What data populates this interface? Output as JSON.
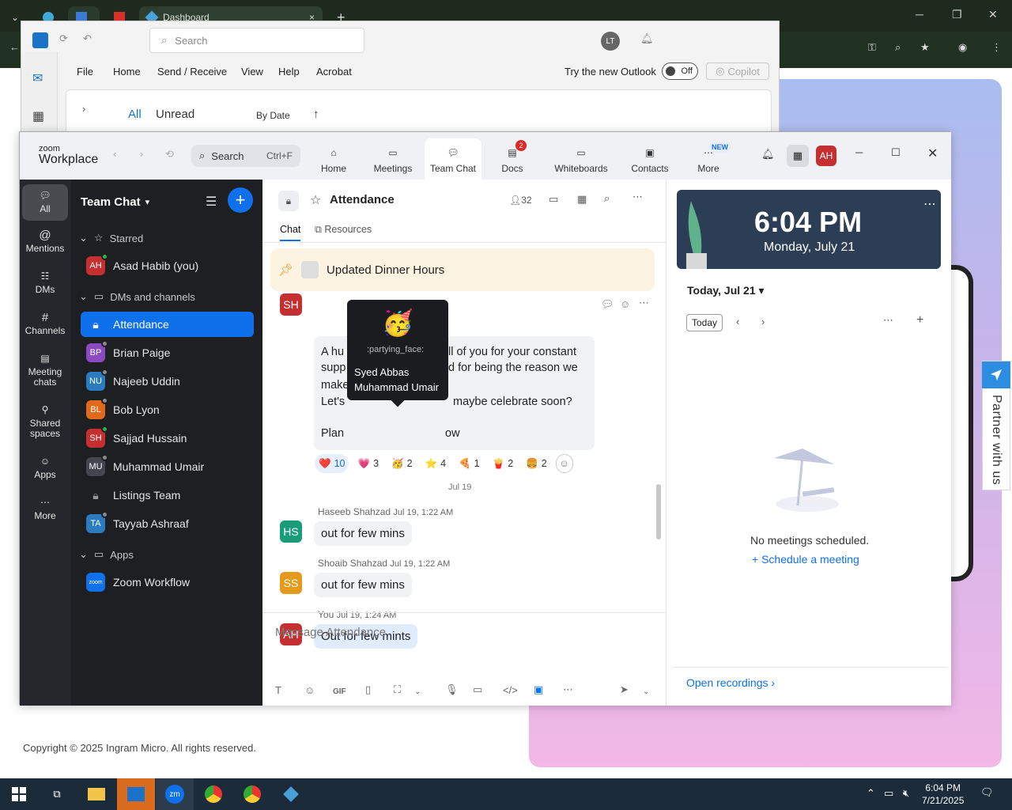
{
  "browser": {
    "tab_title": "Dashboard",
    "tab_close": "×",
    "new_tab": "+"
  },
  "outlook": {
    "search_placeholder": "Search",
    "user_initials": "LT",
    "menu": [
      "File",
      "Home",
      "Send / Receive",
      "View",
      "Help",
      "Acrobat"
    ],
    "try_new": "Try the new Outlook",
    "toggle": "Off",
    "copilot": "Copilot",
    "filters": {
      "all": "All",
      "unread": "Unread",
      "sort": "By Date",
      "sort_dir": "↑"
    }
  },
  "zoom": {
    "brand_top": "zoom",
    "brand": "Workplace",
    "search": "Search",
    "search_shortcut": "Ctrl+F",
    "tabs": [
      {
        "label": "Home"
      },
      {
        "label": "Meetings"
      },
      {
        "label": "Team Chat"
      },
      {
        "label": "Docs",
        "badge": "2"
      },
      {
        "label": "Whiteboards"
      },
      {
        "label": "Contacts"
      },
      {
        "label": "More",
        "badge": "NEW"
      }
    ],
    "user_initials": "AH",
    "rail": [
      "All",
      "Mentions",
      "DMs",
      "Channels",
      "Meeting chats",
      "Shared spaces",
      "Apps",
      "More"
    ],
    "sidebar": {
      "title": "Team Chat",
      "sections": {
        "starred": "Starred",
        "dms": "DMs and channels",
        "apps": "Apps"
      },
      "starred": [
        {
          "initials": "AH",
          "name": "Asad Habib (you)",
          "color": "#c62f2f",
          "status": "#2cb43f"
        }
      ],
      "items": [
        {
          "name": "Attendance",
          "type": "channel"
        },
        {
          "initials": "BP",
          "name": "Brian Paige",
          "color": "#8c4ac2",
          "status": "#8a8a8a"
        },
        {
          "initials": "NU",
          "name": "Najeeb Uddin",
          "color": "#2a7bc0",
          "status": "#8a8a8a"
        },
        {
          "initials": "BL",
          "name": "Bob Lyon",
          "color": "#e06a1a",
          "status": "#8a8a8a"
        },
        {
          "initials": "SH",
          "name": "Sajjad Hussain",
          "color": "#c62f2f",
          "status": "#2cb43f"
        },
        {
          "initials": "MU",
          "name": "Muhammad Umair",
          "color": "#43464f",
          "status": "#8a8a8a"
        },
        {
          "name": "Listings Team",
          "type": "channel"
        },
        {
          "initials": "TA",
          "name": "Tayyab Ashraaf",
          "color": "#2a7bc0",
          "status": "#8a8a8a"
        }
      ],
      "apps": [
        {
          "name": "Zoom Workflow",
          "icon": "zoom"
        }
      ]
    },
    "chat": {
      "channel": "Attendance",
      "members": "32",
      "tabs": {
        "chat": "Chat",
        "resources": "Resources"
      },
      "pinned": "Updated Dinner Hours",
      "sender_initials": "SH",
      "big_message": [
        "A hu",
        "ll of you for your constant",
        "supp",
        "d for being the reason we",
        "make",
        "Let's",
        "maybe celebrate soon?",
        "Plan",
        "ow"
      ],
      "tooltip": {
        "emoji": "🥳",
        "name": ":partying_face:",
        "users": [
          "Syed Abbas",
          "Muhammad Umair"
        ]
      },
      "reactions": [
        {
          "emoji": "❤️",
          "count": "10"
        },
        {
          "emoji": "💗",
          "count": "3"
        },
        {
          "emoji": "🥳",
          "count": "2"
        },
        {
          "emoji": "⭐",
          "count": "4"
        },
        {
          "emoji": "🍕",
          "count": "1"
        },
        {
          "emoji": "🍟",
          "count": "2"
        },
        {
          "emoji": "🍔",
          "count": "2"
        }
      ],
      "date_divider": "Jul 19",
      "messages": [
        {
          "initials": "HS",
          "color": "#1a9b7a",
          "sender": "Haseeb Shahzad",
          "time": "Jul 19, 1:22 AM",
          "text": "out for few mins"
        },
        {
          "initials": "SS",
          "color": "#e59a1b",
          "sender": "Shoaib Shahzad",
          "time": "Jul 19, 1:22 AM",
          "text": "out for few mins"
        },
        {
          "initials": "AH",
          "color": "#c62f2f",
          "sender": "You",
          "time": "Jul 19, 1:24 AM",
          "text": "Out for few mints"
        }
      ],
      "composer_placeholder": "Message Attendance"
    },
    "calendar": {
      "time": "6:04 PM",
      "date": "Monday, July 21",
      "today_label": "Today, Jul 21",
      "today_button": "Today",
      "empty": "No meetings scheduled.",
      "schedule": "Schedule a meeting",
      "recordings": "Open recordings"
    }
  },
  "page": {
    "copyright": "Copyright © 2025 Ingram Micro. All rights reserved.",
    "partner": "Partner with us"
  },
  "taskbar": {
    "time": "6:04 PM",
    "date": "7/21/2025"
  }
}
